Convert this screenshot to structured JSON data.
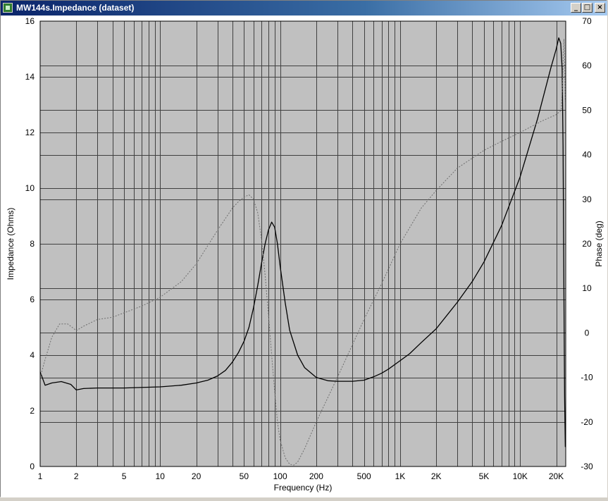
{
  "window": {
    "title": "MW144s.Impedance (dataset)",
    "buttons": {
      "minimize": "_",
      "maximize": "□",
      "close": "×"
    }
  },
  "colors": {
    "plot_background": "#c0c0c0",
    "grid": "#404040",
    "impedance_line": "#000000",
    "phase_line": "#6e6e6e"
  },
  "chart_data": {
    "type": "line",
    "title": "",
    "xlabel": "Frequency (Hz)",
    "ylabel": "Impedance (Ohms)",
    "y2label": "Phase (deg)",
    "x_scale": "log",
    "xlim": [
      1,
      24000
    ],
    "ylim": [
      0,
      16
    ],
    "y2lim": [
      -30,
      70
    ],
    "grid": true,
    "x_ticks": [
      {
        "value": 1,
        "label": "1"
      },
      {
        "value": 2,
        "label": "2"
      },
      {
        "value": 5,
        "label": "5"
      },
      {
        "value": 10,
        "label": "10"
      },
      {
        "value": 20,
        "label": "20"
      },
      {
        "value": 50,
        "label": "50"
      },
      {
        "value": 100,
        "label": "100"
      },
      {
        "value": 200,
        "label": "200"
      },
      {
        "value": 500,
        "label": "500"
      },
      {
        "value": 1000,
        "label": "1K"
      },
      {
        "value": 2000,
        "label": "2K"
      },
      {
        "value": 5000,
        "label": "5K"
      },
      {
        "value": 10000,
        "label": "10K"
      },
      {
        "value": 20000,
        "label": "20K"
      }
    ],
    "y_ticks": [
      {
        "value": 0,
        "label": "0"
      },
      {
        "value": 2,
        "label": "2"
      },
      {
        "value": 4,
        "label": "4"
      },
      {
        "value": 6,
        "label": "6"
      },
      {
        "value": 8,
        "label": "8"
      },
      {
        "value": 10,
        "label": "10"
      },
      {
        "value": 12,
        "label": "12"
      },
      {
        "value": 14,
        "label": "14"
      },
      {
        "value": 16,
        "label": "16"
      }
    ],
    "y2_ticks": [
      {
        "value": -30,
        "label": "-30"
      },
      {
        "value": -20,
        "label": "-20"
      },
      {
        "value": -10,
        "label": "-10"
      },
      {
        "value": 0,
        "label": "0"
      },
      {
        "value": 10,
        "label": "10"
      },
      {
        "value": 20,
        "label": "20"
      },
      {
        "value": 30,
        "label": "30"
      },
      {
        "value": 40,
        "label": "40"
      },
      {
        "value": 50,
        "label": "50"
      },
      {
        "value": 60,
        "label": "60"
      },
      {
        "value": 70,
        "label": "70"
      }
    ],
    "series": [
      {
        "axis": "left",
        "style": "solid",
        "points": [
          [
            1,
            3.4
          ],
          [
            1.1,
            2.92
          ],
          [
            1.25,
            3.0
          ],
          [
            1.5,
            3.05
          ],
          [
            1.8,
            2.95
          ],
          [
            2,
            2.75
          ],
          [
            2.3,
            2.8
          ],
          [
            3,
            2.82
          ],
          [
            5,
            2.82
          ],
          [
            10,
            2.86
          ],
          [
            15,
            2.92
          ],
          [
            20,
            3.0
          ],
          [
            25,
            3.1
          ],
          [
            30,
            3.25
          ],
          [
            35,
            3.45
          ],
          [
            40,
            3.75
          ],
          [
            45,
            4.1
          ],
          [
            50,
            4.5
          ],
          [
            55,
            5.0
          ],
          [
            60,
            5.7
          ],
          [
            65,
            6.5
          ],
          [
            70,
            7.3
          ],
          [
            75,
            8.0
          ],
          [
            80,
            8.5
          ],
          [
            85,
            8.78
          ],
          [
            90,
            8.6
          ],
          [
            95,
            8.0
          ],
          [
            100,
            7.2
          ],
          [
            110,
            5.9
          ],
          [
            120,
            4.9
          ],
          [
            140,
            4.0
          ],
          [
            160,
            3.55
          ],
          [
            200,
            3.2
          ],
          [
            250,
            3.08
          ],
          [
            300,
            3.06
          ],
          [
            400,
            3.06
          ],
          [
            500,
            3.1
          ],
          [
            600,
            3.22
          ],
          [
            700,
            3.35
          ],
          [
            800,
            3.5
          ],
          [
            1000,
            3.8
          ],
          [
            1200,
            4.05
          ],
          [
            1500,
            4.45
          ],
          [
            2000,
            4.95
          ],
          [
            3000,
            5.9
          ],
          [
            4000,
            6.65
          ],
          [
            5000,
            7.35
          ],
          [
            7000,
            8.65
          ],
          [
            10000,
            10.4
          ],
          [
            14000,
            12.5
          ],
          [
            18000,
            14.3
          ],
          [
            20000,
            15.0
          ],
          [
            21000,
            15.4
          ],
          [
            21800,
            15.2
          ],
          [
            22400,
            14.3
          ],
          [
            22800,
            11.5
          ],
          [
            23200,
            6.0
          ],
          [
            23500,
            2.5
          ],
          [
            23800,
            0.7
          ]
        ]
      },
      {
        "axis": "right",
        "style": "dotted",
        "points": [
          [
            1,
            -10
          ],
          [
            1.1,
            -6
          ],
          [
            1.25,
            -1
          ],
          [
            1.45,
            2
          ],
          [
            1.7,
            2
          ],
          [
            1.9,
            1
          ],
          [
            2,
            0.5
          ],
          [
            2.3,
            1.5
          ],
          [
            3,
            3
          ],
          [
            4,
            3.5
          ],
          [
            5,
            4.5
          ],
          [
            7,
            6
          ],
          [
            10,
            8
          ],
          [
            15,
            11.5
          ],
          [
            20,
            15.5
          ],
          [
            30,
            23
          ],
          [
            40,
            28
          ],
          [
            45,
            29.5
          ],
          [
            50,
            30.5
          ],
          [
            55,
            31
          ],
          [
            60,
            30
          ],
          [
            65,
            27
          ],
          [
            70,
            21
          ],
          [
            75,
            13
          ],
          [
            80,
            4
          ],
          [
            85,
            -5
          ],
          [
            90,
            -13
          ],
          [
            95,
            -20
          ],
          [
            100,
            -24
          ],
          [
            110,
            -28
          ],
          [
            120,
            -29.5
          ],
          [
            130,
            -29.7
          ],
          [
            140,
            -29
          ],
          [
            160,
            -26
          ],
          [
            200,
            -20
          ],
          [
            300,
            -10
          ],
          [
            500,
            3
          ],
          [
            700,
            11
          ],
          [
            1000,
            20
          ],
          [
            1500,
            28
          ],
          [
            2000,
            32
          ],
          [
            3000,
            37
          ],
          [
            5000,
            41
          ],
          [
            7000,
            43
          ],
          [
            10000,
            45
          ],
          [
            15000,
            47.5
          ],
          [
            20000,
            49
          ],
          [
            22000,
            50
          ],
          [
            22500,
            55
          ],
          [
            22900,
            62
          ],
          [
            23200,
            66
          ],
          [
            23500,
            62
          ],
          [
            23800,
            52
          ]
        ]
      }
    ]
  }
}
